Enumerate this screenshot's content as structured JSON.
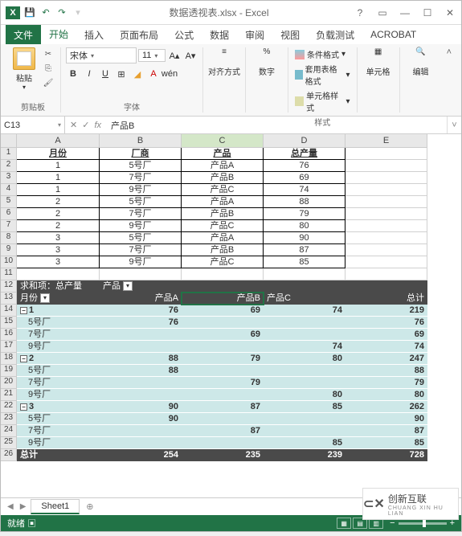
{
  "title": "数据透视表.xlsx - Excel",
  "tabs": {
    "file": "文件",
    "home": "开始",
    "insert": "插入",
    "layout": "页面布局",
    "formulas": "公式",
    "data": "数据",
    "review": "审阅",
    "view": "视图",
    "loadtest": "负载测试",
    "acrobat": "ACROBAT"
  },
  "ribbon": {
    "paste": "粘贴",
    "clipboard_group": "剪贴板",
    "font_name": "宋体",
    "font_size": "11",
    "font_group": "字体",
    "align_btn": "对齐方式",
    "number_btn": "数字",
    "cond_fmt": "条件格式",
    "table_fmt": "套用表格格式",
    "cell_styles": "单元格样式",
    "styles_group": "样式",
    "cells_btn": "单元格",
    "edit_btn": "编辑"
  },
  "namebox": "C13",
  "formula": "产品B",
  "headers": [
    "A",
    "B",
    "C",
    "D",
    "E"
  ],
  "data_hdr": {
    "a": "月份",
    "b": "厂商",
    "c": "产品",
    "d": "总产量"
  },
  "rows": [
    {
      "a": "1",
      "b": "5号厂",
      "c": "产品A",
      "d": "76"
    },
    {
      "a": "1",
      "b": "7号厂",
      "c": "产品B",
      "d": "69"
    },
    {
      "a": "1",
      "b": "9号厂",
      "c": "产品C",
      "d": "74"
    },
    {
      "a": "2",
      "b": "5号厂",
      "c": "产品A",
      "d": "88"
    },
    {
      "a": "2",
      "b": "7号厂",
      "c": "产品B",
      "d": "79"
    },
    {
      "a": "2",
      "b": "9号厂",
      "c": "产品C",
      "d": "80"
    },
    {
      "a": "3",
      "b": "5号厂",
      "c": "产品A",
      "d": "90"
    },
    {
      "a": "3",
      "b": "7号厂",
      "c": "产品B",
      "d": "87"
    },
    {
      "a": "3",
      "b": "9号厂",
      "c": "产品C",
      "d": "85"
    }
  ],
  "pivot": {
    "sum_label": "求和项：总产量",
    "product_label": "产品",
    "month_label": "月份",
    "prodA": "产品A",
    "prodB": "产品B",
    "prodC": "产品C",
    "total_label": "总计",
    "groups": [
      {
        "m": "1",
        "a": "76",
        "b": "69",
        "c": "74",
        "t": "219",
        "detail": [
          {
            "f": "5号厂",
            "a": "76",
            "b": "",
            "c": "",
            "t": "76"
          },
          {
            "f": "7号厂",
            "a": "",
            "b": "69",
            "c": "",
            "t": "69"
          },
          {
            "f": "9号厂",
            "a": "",
            "b": "",
            "c": "74",
            "t": "74"
          }
        ]
      },
      {
        "m": "2",
        "a": "88",
        "b": "79",
        "c": "80",
        "t": "247",
        "detail": [
          {
            "f": "5号厂",
            "a": "88",
            "b": "",
            "c": "",
            "t": "88"
          },
          {
            "f": "7号厂",
            "a": "",
            "b": "79",
            "c": "",
            "t": "79"
          },
          {
            "f": "9号厂",
            "a": "",
            "b": "",
            "c": "80",
            "t": "80"
          }
        ]
      },
      {
        "m": "3",
        "a": "90",
        "b": "87",
        "c": "85",
        "t": "262",
        "detail": [
          {
            "f": "5号厂",
            "a": "90",
            "b": "",
            "c": "",
            "t": "90"
          },
          {
            "f": "7号厂",
            "a": "",
            "b": "87",
            "c": "",
            "t": "87"
          },
          {
            "f": "9号厂",
            "a": "",
            "b": "",
            "c": "85",
            "t": "85"
          }
        ]
      }
    ],
    "grand": {
      "a": "254",
      "b": "235",
      "c": "239",
      "t": "728"
    }
  },
  "sheet_name": "Sheet1",
  "status": "就绪",
  "watermark": {
    "brand": "创新互联",
    "sub": "CHUANG XIN HU LIAN"
  }
}
